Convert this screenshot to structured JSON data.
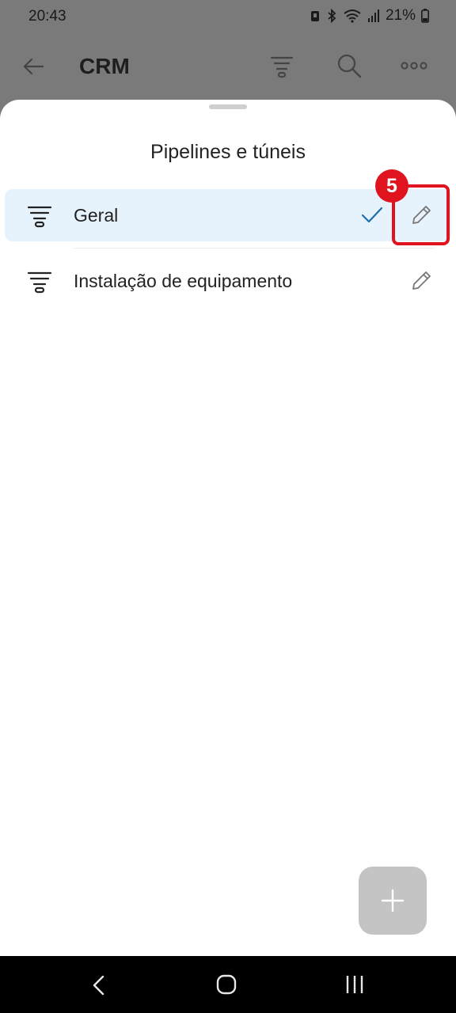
{
  "status_bar": {
    "time": "20:43",
    "battery": "21%"
  },
  "app_bar": {
    "title": "CRM",
    "icons": [
      "back-arrow-icon",
      "funnel-icon",
      "search-icon",
      "more-icon"
    ]
  },
  "sheet": {
    "title": "Pipelines e túneis",
    "items": [
      {
        "label": "Geral",
        "selected": true,
        "icon": "funnel-icon"
      },
      {
        "label": "Instalação de equipamento",
        "selected": false,
        "icon": "funnel-icon"
      }
    ]
  },
  "annotation": {
    "step": "5",
    "color": "#e0141e"
  },
  "fab": {
    "icon": "plus-icon"
  },
  "nav_bar": {
    "icons": [
      "back-icon",
      "home-icon",
      "recents-icon"
    ]
  },
  "colors": {
    "selected_row": "#e6f3fc",
    "check": "#1b6ea8",
    "scrim": "#7a7a7a"
  }
}
